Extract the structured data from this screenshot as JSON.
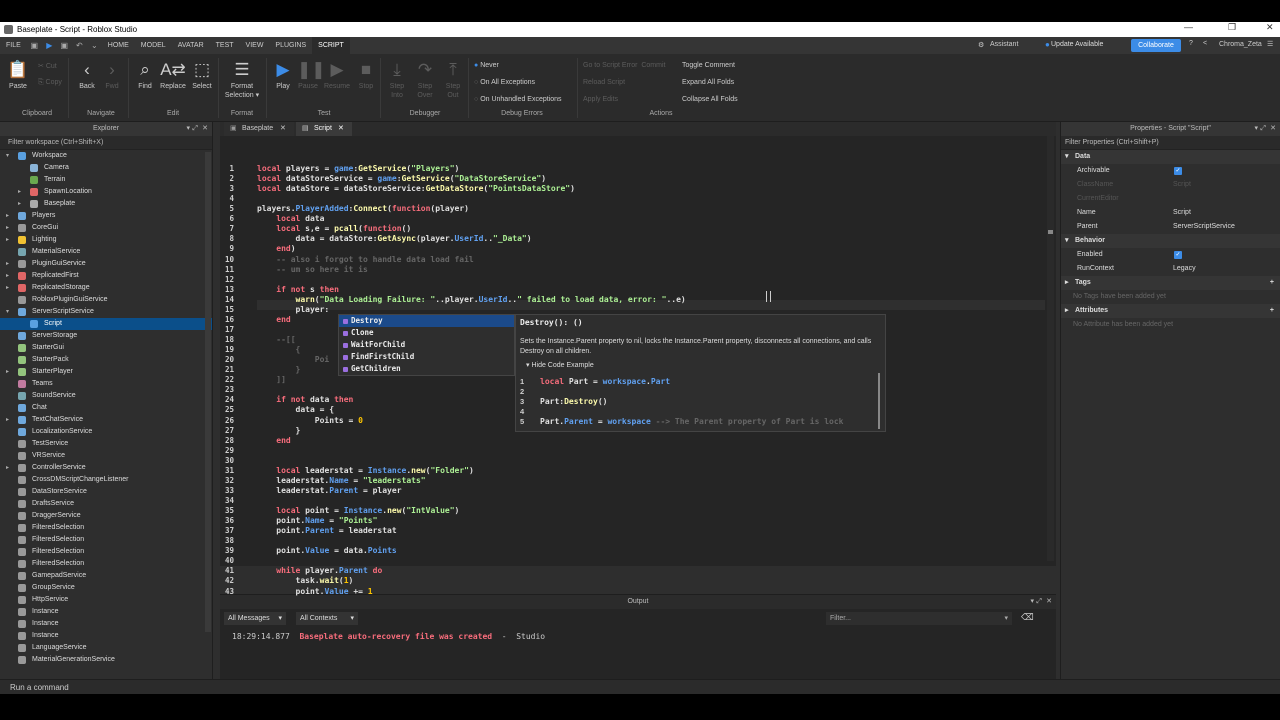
{
  "window": {
    "title": "Baseplate - Script - Roblox Studio"
  },
  "menubar": {
    "file": "FILE",
    "tabs": [
      "HOME",
      "MODEL",
      "AVATAR",
      "TEST",
      "VIEW",
      "PLUGINS",
      "SCRIPT"
    ],
    "active_tab": "SCRIPT",
    "assistant": "Assistant",
    "update": "Update Available",
    "collaborate": "Collaborate",
    "user": "Chroma_Zeta"
  },
  "ribbon": {
    "paste": "Paste",
    "cut": "Cut",
    "copy": "Copy",
    "back": "Back",
    "fwd": "Fwd",
    "find": "Find",
    "replace": "Replace",
    "select": "Select",
    "format_selection": [
      "Format",
      "Selection"
    ],
    "play": "Play",
    "pause": "Pause",
    "resume": "Resume",
    "stop": "Stop",
    "step_into": [
      "Step",
      "Into"
    ],
    "step_over": [
      "Step",
      "Over"
    ],
    "step_out": [
      "Step",
      "Out"
    ],
    "never": "Never",
    "all_exceptions": "On All Exceptions",
    "unhandled": "On Unhandled Exceptions",
    "goto_error": "Go to Script Error",
    "commit": "Commit",
    "reload": "Reload Script",
    "apply_edits": "Apply Edits",
    "toggle_comment": "Toggle Comment",
    "expand_folds": "Expand All Folds",
    "collapse_folds": "Collapse All Folds",
    "groups": [
      "Clipboard",
      "Navigate",
      "Edit",
      "Format",
      "Test",
      "Debugger",
      "Debug Errors",
      "Actions"
    ]
  },
  "explorer": {
    "title": "Explorer",
    "filter": "Filter workspace (Ctrl+Shift+X)",
    "items": [
      {
        "label": "Workspace",
        "color": "#5aa0e0"
      },
      {
        "label": "Camera",
        "color": "#8ab4d8"
      },
      {
        "label": "Terrain",
        "color": "#6aa84f"
      },
      {
        "label": "SpawnLocation",
        "color": "#e06666"
      },
      {
        "label": "Baseplate",
        "color": "#aaaaaa"
      },
      {
        "label": "Players",
        "color": "#6fa8dc"
      },
      {
        "label": "CoreGui",
        "color": "#999999"
      },
      {
        "label": "Lighting",
        "color": "#f1c232"
      },
      {
        "label": "MaterialService",
        "color": "#76a5af"
      },
      {
        "label": "PluginGuiService",
        "color": "#999999"
      },
      {
        "label": "ReplicatedFirst",
        "color": "#e06666"
      },
      {
        "label": "ReplicatedStorage",
        "color": "#e06666"
      },
      {
        "label": "RobloxPluginGuiService",
        "color": "#999999"
      },
      {
        "label": "ServerScriptService",
        "color": "#6fa8dc"
      },
      {
        "label": "Script",
        "color": "#5aa0e0"
      },
      {
        "label": "ServerStorage",
        "color": "#6fa8dc"
      },
      {
        "label": "StarterGui",
        "color": "#93c47d"
      },
      {
        "label": "StarterPack",
        "color": "#93c47d"
      },
      {
        "label": "StarterPlayer",
        "color": "#93c47d"
      },
      {
        "label": "Teams",
        "color": "#c27ba0"
      },
      {
        "label": "SoundService",
        "color": "#76a5af"
      },
      {
        "label": "Chat",
        "color": "#6fa8dc"
      },
      {
        "label": "TextChatService",
        "color": "#6fa8dc"
      },
      {
        "label": "LocalizationService",
        "color": "#6fa8dc"
      },
      {
        "label": "TestService",
        "color": "#999999"
      },
      {
        "label": "VRService",
        "color": "#999999"
      },
      {
        "label": "ControllerService",
        "color": "#999999"
      },
      {
        "label": "CrossDMScriptChangeListener",
        "color": "#999999"
      },
      {
        "label": "DataStoreService",
        "color": "#999999"
      },
      {
        "label": "DraftsService",
        "color": "#999999"
      },
      {
        "label": "DraggerService",
        "color": "#999999"
      },
      {
        "label": "FilteredSelection",
        "color": "#999999"
      },
      {
        "label": "FilteredSelection",
        "color": "#999999"
      },
      {
        "label": "FilteredSelection",
        "color": "#999999"
      },
      {
        "label": "FilteredSelection",
        "color": "#999999"
      },
      {
        "label": "GamepadService",
        "color": "#999999"
      },
      {
        "label": "GroupService",
        "color": "#999999"
      },
      {
        "label": "HttpService",
        "color": "#999999"
      },
      {
        "label": "Instance",
        "color": "#999999"
      },
      {
        "label": "Instance",
        "color": "#999999"
      },
      {
        "label": "Instance",
        "color": "#999999"
      },
      {
        "label": "LanguageService",
        "color": "#999999"
      },
      {
        "label": "MaterialGenerationService",
        "color": "#999999"
      }
    ]
  },
  "editor": {
    "tabs": [
      "Baseplate",
      "Script"
    ],
    "active_tab": "Script",
    "lines": [
      {
        "n": "1",
        "h": "<span class='k'>local</span> players = <span class='p'>game</span>:<span class='f'>GetService</span>(<span class='s'>\"Players\"</span>)"
      },
      {
        "n": "2",
        "h": "<span class='k'>local</span> dataStoreService = <span class='p'>game</span>:<span class='f'>GetService</span>(<span class='s'>\"DataStoreService\"</span>)"
      },
      {
        "n": "3",
        "h": "<span class='k'>local</span> dataStore = dataStoreService:<span class='f'>GetDataStore</span>(<span class='s'>\"PointsDataStore\"</span>)"
      },
      {
        "n": "4",
        "h": ""
      },
      {
        "n": "5",
        "h": "players.<span class='p'>PlayerAdded</span>:<span class='f'>Connect</span>(<span class='k'>function</span>(player)"
      },
      {
        "n": "6",
        "h": "    <span class='k'>local</span> data"
      },
      {
        "n": "7",
        "h": "    <span class='k'>local</span> s,e = <span class='f'>pcall</span>(<span class='k'>function</span>()"
      },
      {
        "n": "8",
        "h": "        data = dataStore:<span class='f'>GetAsync</span>(player.<span class='p'>UserId</span>..<span class='s'>\"_Data\"</span>)"
      },
      {
        "n": "9",
        "h": "    <span class='k'>end</span>)"
      },
      {
        "n": "10",
        "h": "    <span class='c'>-- also i forgot to handle data load fail</span>"
      },
      {
        "n": "11",
        "h": "    <span class='c'>-- um so here it is</span>"
      },
      {
        "n": "12",
        "h": ""
      },
      {
        "n": "13",
        "h": "    <span class='k'>if not</span> s <span class='k'>then</span>"
      },
      {
        "n": "14",
        "h": "        <span class='f'>warn</span>(<span class='s'>\"Data Loading Failure: \"</span>..player.<span class='p'>UserId</span>..<span class='s'>\" failed to load data, error: \"</span>..e)"
      },
      {
        "n": "15",
        "h": "        player:"
      },
      {
        "n": "16",
        "h": "    <span class='k'>end</span>"
      },
      {
        "n": "17",
        "h": ""
      },
      {
        "n": "18",
        "h": "    <span class='c'>--[[</span>"
      },
      {
        "n": "19",
        "h": "    <span class='c'>    {</span>"
      },
      {
        "n": "20",
        "h": "    <span class='c'>        Poi</span>"
      },
      {
        "n": "21",
        "h": "    <span class='c'>    }</span>"
      },
      {
        "n": "22",
        "h": "    <span class='c'>]]</span>"
      },
      {
        "n": "23",
        "h": ""
      },
      {
        "n": "24",
        "h": "    <span class='k'>if not</span> data <span class='k'>then</span>"
      },
      {
        "n": "25",
        "h": "        data = {"
      },
      {
        "n": "26",
        "h": "            Points = <span class='n'>0</span>"
      },
      {
        "n": "27",
        "h": "        }"
      },
      {
        "n": "28",
        "h": "    <span class='k'>end</span>"
      },
      {
        "n": "29",
        "h": ""
      },
      {
        "n": "30",
        "h": ""
      },
      {
        "n": "31",
        "h": "    <span class='k'>local</span> leaderstat = <span class='p'>Instance</span>.<span class='f'>new</span>(<span class='s'>\"Folder\"</span>)"
      },
      {
        "n": "32",
        "h": "    leaderstat.<span class='p'>Name</span> = <span class='s'>\"leaderstats\"</span>"
      },
      {
        "n": "33",
        "h": "    leaderstat.<span class='p'>Parent</span> = player"
      },
      {
        "n": "34",
        "h": ""
      },
      {
        "n": "35",
        "h": "    <span class='k'>local</span> point = <span class='p'>Instance</span>.<span class='f'>new</span>(<span class='s'>\"IntValue\"</span>)"
      },
      {
        "n": "36",
        "h": "    point.<span class='p'>Name</span> = <span class='s'>\"Points\"</span>"
      },
      {
        "n": "37",
        "h": "    point.<span class='p'>Parent</span> = leaderstat"
      },
      {
        "n": "38",
        "h": ""
      },
      {
        "n": "39",
        "h": "    point.<span class='p'>Value</span> = data.<span class='p'>Points</span>"
      },
      {
        "n": "40",
        "h": ""
      },
      {
        "n": "41",
        "h": "    <span class='k'>while</span> player.<span class='p'>Parent</span> <span class='k'>do</span>"
      },
      {
        "n": "42",
        "h": "        task.<span class='f'>wait</span>(<span class='n'>1</span>)"
      },
      {
        "n": "43",
        "h": "        point.<span class='p'>Value</span> += <span class='n'>1</span>"
      }
    ]
  },
  "autocomplete": {
    "items": [
      "Destroy",
      "Clone",
      "WaitForChild",
      "FindFirstChild",
      "GetChildren"
    ],
    "selected": "Destroy",
    "signature": "Destroy(): ()",
    "description": "Sets the Instance.Parent property to nil, locks the Instance.Parent property, disconnects all connections, and calls Destroy on all children.",
    "toggle": "Hide Code Example",
    "example": [
      {
        "n": "1",
        "h": "<span class='k'>local</span> Part = <span class='p'>workspace</span>.<span class='p'>Part</span>"
      },
      {
        "n": "2",
        "h": ""
      },
      {
        "n": "3",
        "h": "Part:<span class='f'>Destroy</span>()"
      },
      {
        "n": "4",
        "h": ""
      },
      {
        "n": "5",
        "h": "Part.<span class='p'>Parent</span> = <span class='p'>workspace</span> <span class='c'>--> The Parent property of Part is lock</span>"
      }
    ]
  },
  "properties": {
    "title": "Properties - Script \"Script\"",
    "filter": "Filter Properties (Ctrl+Shift+P)",
    "data_section": "Data",
    "archivable": "Archivable",
    "classname": "ClassName",
    "classname_val": "Script",
    "current_editor": "CurrentEditor",
    "name": "Name",
    "name_val": "Script",
    "parent": "Parent",
    "parent_val": "ServerScriptService",
    "behavior_section": "Behavior",
    "enabled": "Enabled",
    "runcontext": "RunContext",
    "runcontext_val": "Legacy",
    "tags_section": "Tags",
    "no_tags": "No Tags have been added yet",
    "attributes_section": "Attributes",
    "no_attrs": "No Attribute has been added yet"
  },
  "output": {
    "title": "Output",
    "messages": "All Messages",
    "contexts": "All Contexts",
    "filter": "Filter...",
    "time": "18:29:14.877",
    "msg": "Baseplate auto-recovery file was created",
    "dash": "-",
    "source": "Studio"
  },
  "command": {
    "placeholder": "Run a command"
  }
}
